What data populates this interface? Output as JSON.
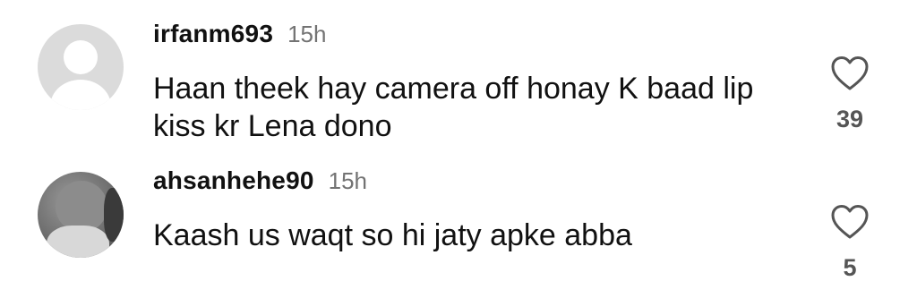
{
  "comments": [
    {
      "username": "irfanm693",
      "time": "15h",
      "text": "Haan theek hay camera off honay K baad lip kiss kr Lena dono",
      "likes": "39",
      "avatar": "default-avatar"
    },
    {
      "username": "ahsanhehe90",
      "time": "15h",
      "text": "Kaash us waqt so hi jaty apke abba",
      "likes": "5",
      "avatar": "photo-avatar"
    }
  ],
  "colors": {
    "text": "#111111",
    "muted": "#737373",
    "avatar_bg": "#dbdbdb"
  },
  "icons": {
    "like": "heart-outline-icon"
  }
}
